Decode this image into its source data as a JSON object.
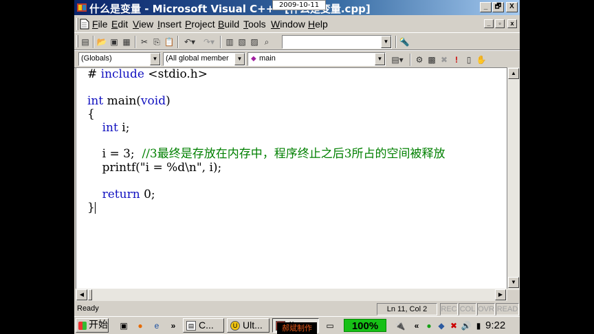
{
  "window": {
    "title": "什么是变量 - Microsoft Visual C++",
    "doc_name": "[什么是变量.cpp]",
    "date_tag": "2009-10-11",
    "min_label": "_",
    "restore_label": "🗗",
    "close_label": "X"
  },
  "menu": {
    "items": [
      "File",
      "Edit",
      "View",
      "Insert",
      "Project",
      "Build",
      "Tools",
      "Window",
      "Help"
    ]
  },
  "toolbar": {
    "find_combo_value": "",
    "scope_combo_value": "(Globals)",
    "members_combo_value": "(All global member",
    "function_combo_value": "main"
  },
  "editor": {
    "lines": [
      "# include <stdio.h>",
      "",
      "int main(void)",
      "{",
      "    int i;",
      "",
      "    i = 3;  //3最终是存放在内存中，程序终止之后3所占的空间被释放",
      "    printf(\"i = %d\\n\", i);",
      "",
      "    return 0;",
      "}"
    ],
    "keywords": [
      "include",
      "int",
      "void",
      "return"
    ]
  },
  "status": {
    "ready": "Ready",
    "position": "Ln 11, Col 2",
    "rec": "REC",
    "col": "COL",
    "ovr": "OVR",
    "read": "READ"
  },
  "taskbar": {
    "start_label": "开始",
    "tasks": [
      {
        "label": "C...",
        "icon": "document-icon"
      },
      {
        "label": "Ult...",
        "icon": "ultra-icon"
      },
      {
        "label": "//",
        "icon": "vc-icon"
      }
    ],
    "watermark": "郝斌制作",
    "percent": "100%",
    "clock": "9:22"
  },
  "colors": {
    "keyword": "#1010c0",
    "comment": "#008000",
    "title_bar": "#0a246a",
    "percent_bg": "#16c016"
  }
}
